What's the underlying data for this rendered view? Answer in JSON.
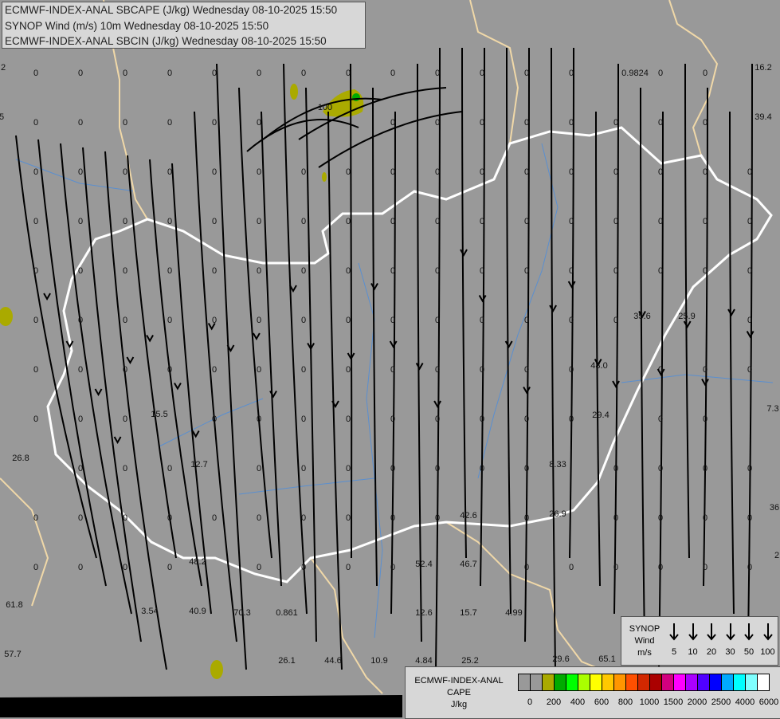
{
  "header": {
    "line1": "ECMWF-INDEX-ANAL SBCAPE (J/kg) Wednesday 08-10-2025 15:50",
    "line2": "SYNOP Wind (m/s) 10m Wednesday 08-10-2025 15:50",
    "line3": "ECMWF-INDEX-ANAL SBCIN (J/kg) Wednesday 08-10-2025 15:50"
  },
  "wind_legend": {
    "title": [
      "SYNOP",
      "Wind",
      "m/s"
    ],
    "speeds": [
      "5",
      "10",
      "20",
      "30",
      "50",
      "100"
    ]
  },
  "cape_legend": {
    "title": [
      "ECMWF-INDEX-ANAL",
      "CAPE",
      "J/kg"
    ],
    "colors": [
      "#999999",
      "#999999",
      "#aaaa00",
      "#00aa00",
      "#00ff00",
      "#aaff00",
      "#ffff00",
      "#ffc800",
      "#ff9600",
      "#ff5000",
      "#d22800",
      "#aa0000",
      "#d2007f",
      "#ff00ff",
      "#aa00ff",
      "#5000ff",
      "#0000ff",
      "#00aaff",
      "#00ffff",
      "#80ffff",
      "#ffffff"
    ],
    "ticks": [
      "0",
      "200",
      "400",
      "600",
      "800",
      "1000",
      "1500",
      "2000",
      "2500",
      "4000",
      "6000"
    ]
  },
  "map": {
    "value_labels": [
      "0.9824",
      "16.2",
      "39.4",
      "35.6",
      "25.9",
      "48.0",
      "29.4",
      "8.33",
      "26.9",
      "42.6",
      "52.4",
      "46.7",
      "12.6",
      "15.7",
      "4.99",
      "4.84",
      "25.2",
      "29.6",
      "65.1",
      "10.9",
      "44.6",
      "26.1",
      "0.861",
      "70.3",
      "40.9",
      "3.54",
      "48.2",
      "12.7",
      "15.5",
      "26.8",
      "61.8",
      "57.7",
      "7.3",
      "36",
      "2",
      "100",
      "2",
      "5"
    ],
    "zero_label": "0",
    "colors": {
      "background": "#999999",
      "hungary_border": "#ffffff",
      "country_border": "#f0d8a8",
      "river": "#5a8fd0",
      "streamline": "#000000",
      "cape_low": "#aaaa00"
    }
  }
}
